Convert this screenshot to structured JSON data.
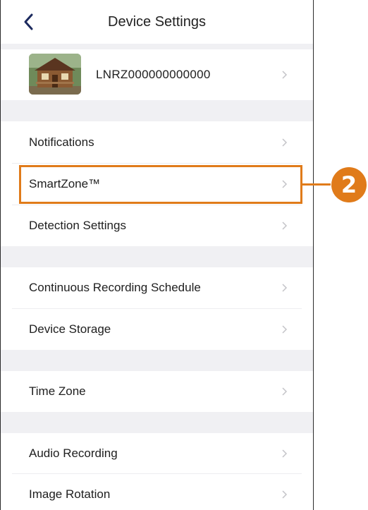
{
  "header": {
    "title": "Device Settings"
  },
  "device": {
    "name": "LNRZ000000000000"
  },
  "menu": {
    "notifications": "Notifications",
    "smartzone": "SmartZone™",
    "detection": "Detection Settings",
    "continuous": "Continuous Recording Schedule",
    "storage": "Device Storage",
    "timezone": "Time Zone",
    "audio": "Audio Recording",
    "rotation": "Image Rotation"
  },
  "callout": {
    "number": "2"
  },
  "colors": {
    "accent": "#e07b1a",
    "back_arrow": "#1c2a5e",
    "separator": "#f0f0f3",
    "chevron": "#c4c4c8"
  },
  "icons": {
    "back": "chevron-left-icon",
    "row": "chevron-right-icon"
  }
}
